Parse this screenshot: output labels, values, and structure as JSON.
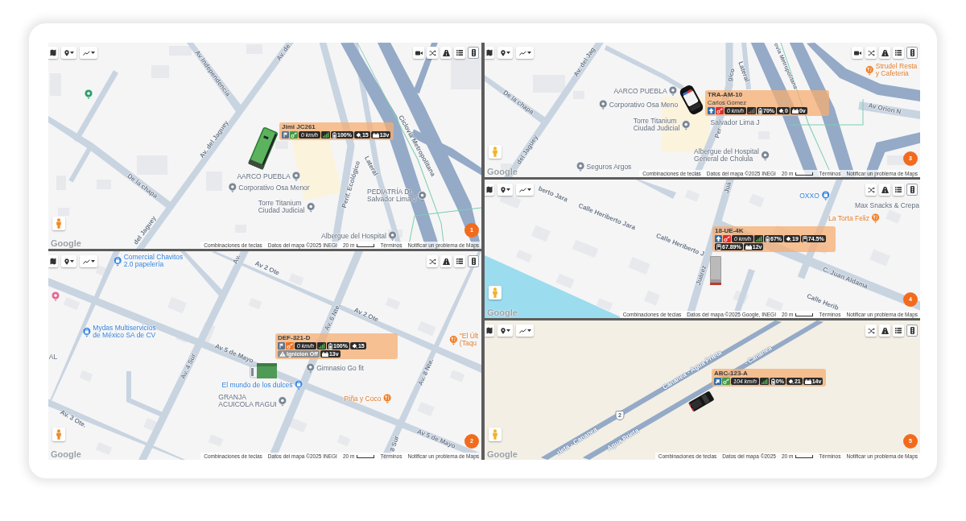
{
  "panels": [
    {
      "number": "1",
      "toolbar": [
        {
          "kind": "video"
        },
        {
          "kind": "shuffle"
        },
        {
          "kind": "road"
        },
        {
          "kind": "list"
        },
        {
          "kind": "traffic"
        }
      ],
      "pegman": {
        "color": "#f08a24"
      },
      "logo": "Google",
      "labels": [
        {
          "kind": "street",
          "text": "Av. de"
        },
        {
          "kind": "street",
          "text": "Av Independencia"
        },
        {
          "kind": "street",
          "text": "Av. del Jaguey"
        },
        {
          "kind": "street",
          "text": "De la chapa"
        },
        {
          "kind": "place",
          "lines": [
            "AARCO PUEBLA"
          ]
        },
        {
          "kind": "place",
          "lines": [
            "Corporativo Osa Menor"
          ]
        },
        {
          "kind": "place",
          "lines": [
            "Torre Titanium",
            "Ciudad Judicial"
          ]
        },
        {
          "kind": "street",
          "text": "Perif. Ecológico"
        },
        {
          "kind": "street",
          "text": "Lateral"
        },
        {
          "kind": "place",
          "lines": [
            "PEDIATRÍA Dr.",
            "Salvador Lima J"
          ]
        },
        {
          "kind": "street",
          "text": "Ciclovía Metropolitana"
        },
        {
          "kind": "place",
          "lines": [
            "Albergue del Hospital"
          ]
        },
        {
          "kind": "street",
          "text": "del Jaguey"
        }
      ],
      "vehicle": {
        "kind": "bus",
        "plate": "Jimi JC261",
        "chips": [
          [
            {
              "kind": "parked"
            },
            {
              "kind": "ignition",
              "color": "#3f9b45"
            },
            {
              "kind": "speed",
              "text": "0 km/h"
            },
            {
              "kind": "signal",
              "on": true
            },
            {
              "kind": "battery",
              "text": "100%"
            },
            {
              "kind": "satellites",
              "text": "15"
            },
            {
              "kind": "voltage",
              "text": "13v"
            }
          ]
        ]
      },
      "footer": {
        "shortcuts": "Combinaciones de teclas",
        "map_data": "Datos del mapa ©2025 INEGI",
        "scale": "20 m",
        "terms": "Términos",
        "report": "Notificar un problema de Maps"
      }
    },
    {
      "number": "2",
      "toolbar": [
        {
          "kind": "shuffle"
        },
        {
          "kind": "road"
        },
        {
          "kind": "list"
        },
        {
          "kind": "traffic"
        }
      ],
      "pegman": {
        "color": "#f08a24"
      },
      "logo": "Google",
      "labels": [
        {
          "kind": "shop",
          "lines": [
            "Comercial Chavitos",
            "2.0 papelería"
          ]
        },
        {
          "kind": "street",
          "text": "Av."
        },
        {
          "kind": "street",
          "text": "Av 2 Ote"
        },
        {
          "kind": "street",
          "text": "Av 2 Ote"
        },
        {
          "kind": "street",
          "text": "Av. 6 Nte."
        },
        {
          "kind": "shop",
          "lines": [
            "Mydas Multiservicios",
            "de México SA de CV"
          ]
        },
        {
          "kind": "place",
          "lines": [
            "AL"
          ]
        },
        {
          "kind": "street",
          "text": "Av 5 de Mayo"
        },
        {
          "kind": "street",
          "text": "Av. 4 Sur"
        },
        {
          "kind": "place",
          "lines": [
            "Gimnasio Go fit"
          ]
        },
        {
          "kind": "shop",
          "lines": [
            "El mundo de los dulces"
          ]
        },
        {
          "kind": "place",
          "lines": [
            "GRANJA",
            "ACUICOLA RAGUI"
          ]
        },
        {
          "kind": "food",
          "lines": [
            "Piña y Coco"
          ]
        },
        {
          "kind": "food",
          "lines": [
            "\"El Últ",
            "(Taqu"
          ]
        },
        {
          "kind": "street",
          "text": "Av. 8 Nte."
        },
        {
          "kind": "street",
          "text": "8 Sur"
        },
        {
          "kind": "street",
          "text": "Av 5 de Mayo"
        },
        {
          "kind": "street",
          "text": "Av. 3 Ote."
        }
      ],
      "vehicle": {
        "kind": "truck",
        "plate": "DEF-321-D",
        "chips": [
          [
            {
              "kind": "parked"
            },
            {
              "kind": "ignition",
              "color": "#f07022"
            },
            {
              "kind": "speed",
              "text": "0 km/h"
            },
            {
              "kind": "signal",
              "on": true
            },
            {
              "kind": "battery",
              "text": "100%"
            },
            {
              "kind": "satellites",
              "text": "15"
            }
          ],
          [
            {
              "kind": "alert",
              "text": "Ignicion Off"
            },
            {
              "kind": "voltage",
              "text": "13v"
            }
          ]
        ]
      },
      "footer": {
        "shortcuts": "Combinaciones de teclas",
        "map_data": "Datos del mapa ©2025 INEGI",
        "scale": "20 m",
        "terms": "Términos",
        "report": "Notificar un problema de Maps"
      }
    },
    {
      "number": "3",
      "toolbar": [
        {
          "kind": "video"
        },
        {
          "kind": "shuffle"
        },
        {
          "kind": "road"
        },
        {
          "kind": "list"
        },
        {
          "kind": "traffic"
        }
      ],
      "pegman": {
        "color": "#f0b323"
      },
      "logo": "Google",
      "labels": [
        {
          "kind": "street",
          "text": "Av. del Jag"
        },
        {
          "kind": "street",
          "text": "De la chapa"
        },
        {
          "kind": "place",
          "lines": [
            "AARCO PUEBLA"
          ]
        },
        {
          "kind": "place",
          "lines": [
            "Corporativo Osa Meno"
          ]
        },
        {
          "kind": "place",
          "lines": [
            "Torre Titanium",
            "Ciudad Judicial"
          ]
        },
        {
          "kind": "street",
          "text": "gico"
        },
        {
          "kind": "street",
          "text": "Lateral"
        },
        {
          "kind": "street",
          "text": "ovia Metropolitana"
        },
        {
          "kind": "food",
          "lines": [
            "Strudel Resta",
            "y Cafeteria"
          ]
        },
        {
          "kind": "street",
          "text": "Av Orion N"
        },
        {
          "kind": "place",
          "lines": [
            "Salvador Lima J"
          ]
        },
        {
          "kind": "street",
          "text": "Per"
        },
        {
          "kind": "place",
          "lines": [
            "Albergue del Hospital",
            "General de Cholula"
          ]
        },
        {
          "kind": "place",
          "lines": [
            "Seguros Argos"
          ]
        },
        {
          "kind": "street",
          "text": "del Jaguey"
        }
      ],
      "vehicle": {
        "kind": "police-car",
        "plate": "TRA-AM-10",
        "driver": "Carlos Gómez",
        "chips": [
          [
            {
              "kind": "heading",
              "diagonal": false
            },
            {
              "kind": "ignition",
              "color": "#e52a2a"
            },
            {
              "kind": "speed",
              "text": "0 km/h"
            },
            {
              "kind": "signal",
              "on": false
            },
            {
              "kind": "battery",
              "text": "70%"
            },
            {
              "kind": "satellites",
              "text": "0"
            },
            {
              "kind": "voltage",
              "text": "0v"
            }
          ]
        ]
      },
      "footer": {
        "shortcuts": "Combinaciones de teclas",
        "map_data": "Datos del mapa ©2025 INEGI",
        "scale": "20 m",
        "terms": "Términos",
        "report": "Notificar un problema de Maps"
      }
    },
    {
      "number": "4",
      "toolbar": [
        {
          "kind": "shuffle"
        },
        {
          "kind": "road"
        },
        {
          "kind": "list"
        },
        {
          "kind": "traffic"
        }
      ],
      "pegman": {
        "color": "#f0b323"
      },
      "logo": "Google",
      "labels": [
        {
          "kind": "street",
          "text": "berto Jara"
        },
        {
          "kind": "street",
          "text": "Juá"
        },
        {
          "kind": "shop",
          "lines": [
            "OXXO"
          ]
        },
        {
          "kind": "place",
          "lines": [
            "Max Snacks & Crepa"
          ]
        },
        {
          "kind": "street",
          "text": "Calle Heriberto Jara"
        },
        {
          "kind": "food",
          "lines": [
            "La Torta Feliz"
          ]
        },
        {
          "kind": "street",
          "text": "Calle Heriberto J"
        },
        {
          "kind": "street",
          "text": "Juárez"
        },
        {
          "kind": "street",
          "text": "C. Juan Aldama"
        },
        {
          "kind": "street",
          "text": "Calle Herib"
        }
      ],
      "vehicle": {
        "kind": "box-truck",
        "plate": "18-UE-4K",
        "chips": [
          [
            {
              "kind": "heading",
              "diagonal": false
            },
            {
              "kind": "ignition",
              "color": "#e52a2a"
            },
            {
              "kind": "speed",
              "text": "0 km/h"
            },
            {
              "kind": "signal",
              "on": true
            },
            {
              "kind": "battery",
              "text": "67%"
            },
            {
              "kind": "satellites",
              "text": "19"
            },
            {
              "kind": "fuel",
              "text": "74.5%"
            }
          ],
          [
            {
              "kind": "fuel",
              "text": "67.89%"
            },
            {
              "kind": "voltage",
              "text": "12v"
            }
          ]
        ]
      },
      "footer": {
        "shortcuts": "Combinaciones de teclas",
        "map_data": "Datos del mapa ©2025 Google, INEGI",
        "scale": "20 m",
        "terms": "Términos",
        "report": "Notificar un problema de Maps"
      }
    },
    {
      "number": "5",
      "toolbar": [
        {
          "kind": "shuffle"
        },
        {
          "kind": "road"
        },
        {
          "kind": "list"
        },
        {
          "kind": "traffic"
        }
      ],
      "pegman": {
        "color": "#f0b323"
      },
      "logo": "Google",
      "labels": [
        {
          "kind": "highway",
          "text": "Cananea - Agua Prieta"
        },
        {
          "kind": "highway",
          "text": "- Cananea"
        },
        {
          "kind": "shield",
          "text": "2"
        },
        {
          "kind": "highway",
          "text": "rieta - Cananea"
        },
        {
          "kind": "highway",
          "text": "Agua Prieta"
        }
      ],
      "vehicle": {
        "kind": "pickup",
        "plate": "ABC-123-A",
        "chips": [
          [
            {
              "kind": "heading",
              "diagonal": true
            },
            {
              "kind": "ignition",
              "color": "#3f9b45"
            },
            {
              "kind": "speed",
              "text": "104 km/h"
            },
            {
              "kind": "signal",
              "on": true
            },
            {
              "kind": "battery",
              "text": "0%"
            },
            {
              "kind": "satellites",
              "text": "21"
            },
            {
              "kind": "voltage",
              "text": "14v"
            }
          ]
        ]
      },
      "footer": {
        "shortcuts": "Combinaciones de teclas",
        "map_data": "Datos del mapa ©2025",
        "scale": "20 m",
        "terms": "Términos",
        "report": "Notificar un problema de Maps"
      }
    }
  ]
}
